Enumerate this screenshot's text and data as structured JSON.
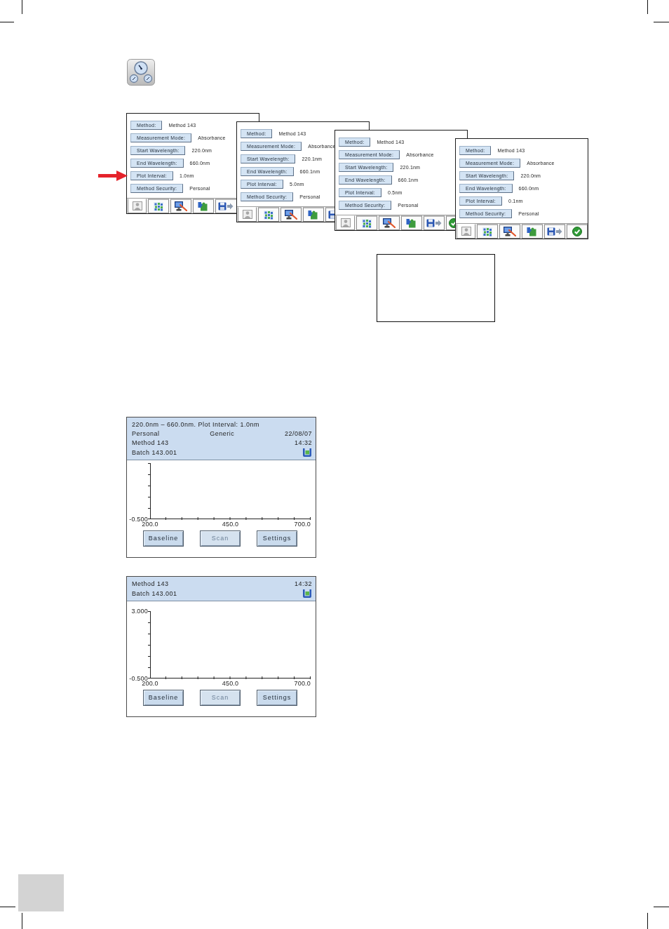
{
  "method_screens": [
    {
      "fields": [
        {
          "label": "Method:",
          "value": "Method 143",
          "arrow": false
        },
        {
          "label": "Measurement Mode:",
          "value": "Absorbance",
          "arrow": false
        },
        {
          "label": "Start Wavelength:",
          "value": "220.0nm",
          "arrow": false
        },
        {
          "label": "End Wavelength:",
          "value": "660.0nm",
          "arrow": false
        },
        {
          "label": "Plot Interval:",
          "value": "1.0nm",
          "arrow": true
        },
        {
          "label": "Method Security:",
          "value": "Personal",
          "arrow": false
        }
      ],
      "tabs": [
        {
          "kind": "user",
          "selected": true
        },
        {
          "kind": "grid",
          "selected": false
        },
        {
          "kind": "monitor",
          "selected": false
        },
        {
          "kind": "puzzle",
          "selected": false
        },
        {
          "kind": "save",
          "selected": false
        }
      ]
    },
    {
      "fields": [
        {
          "label": "Method:",
          "value": "Method 143",
          "arrow": false
        },
        {
          "label": "Measurement Mode:",
          "value": "Absorbance",
          "arrow": false
        },
        {
          "label": "Start Wavelength:",
          "value": "220.1nm",
          "arrow": false
        },
        {
          "label": "End Wavelength:",
          "value": "660.1nm",
          "arrow": false
        },
        {
          "label": "Plot Interval:",
          "value": "5.0nm",
          "arrow": false
        },
        {
          "label": "Method Security:",
          "value": "Personal",
          "arrow": false
        }
      ],
      "tabs": [
        {
          "kind": "user",
          "selected": true
        },
        {
          "kind": "grid",
          "selected": false
        },
        {
          "kind": "monitor",
          "selected": false
        },
        {
          "kind": "puzzle",
          "selected": false
        },
        {
          "kind": "save",
          "selected": false
        }
      ]
    },
    {
      "fields": [
        {
          "label": "Method:",
          "value": "Method 143",
          "arrow": false
        },
        {
          "label": "Measurement Mode:",
          "value": "Absorbance",
          "arrow": false
        },
        {
          "label": "Start Wavelength:",
          "value": "220.1nm",
          "arrow": false
        },
        {
          "label": "End Wavelength:",
          "value": "660.1nm",
          "arrow": false
        },
        {
          "label": "Plot Interval:",
          "value": "0.5nm",
          "arrow": false
        },
        {
          "label": "Method Security:",
          "value": "Personal",
          "arrow": false
        }
      ],
      "tabs": [
        {
          "kind": "user",
          "selected": true
        },
        {
          "kind": "grid",
          "selected": false
        },
        {
          "kind": "monitor",
          "selected": false
        },
        {
          "kind": "puzzle",
          "selected": false
        },
        {
          "kind": "save",
          "selected": false
        },
        {
          "kind": "check",
          "selected": false
        }
      ]
    },
    {
      "fields": [
        {
          "label": "Method:",
          "value": "Method 143",
          "arrow": false
        },
        {
          "label": "Measurement Mode:",
          "value": "Absorbance",
          "arrow": false
        },
        {
          "label": "Start Wavelength:",
          "value": "220.0nm",
          "arrow": false
        },
        {
          "label": "End Wavelength:",
          "value": "660.0nm",
          "arrow": false
        },
        {
          "label": "Plot Interval:",
          "value": "0.1nm",
          "arrow": false
        },
        {
          "label": "Method Security:",
          "value": "Personal",
          "arrow": false
        }
      ],
      "tabs": [
        {
          "kind": "user",
          "selected": true
        },
        {
          "kind": "grid",
          "selected": false
        },
        {
          "kind": "monitor",
          "selected": false
        },
        {
          "kind": "puzzle",
          "selected": false
        },
        {
          "kind": "save",
          "selected": false
        },
        {
          "kind": "check",
          "selected": false
        }
      ]
    }
  ],
  "scan_screens": [
    {
      "header_rows": [
        {
          "left": "220.0nm – 660.0nm. Plot Interval: 1.0nm"
        },
        {
          "left": "Personal",
          "center": "Generic",
          "right": "22/08/07"
        },
        {
          "left": "Method 143",
          "right": "14:32"
        },
        {
          "left": "Batch 143.001"
        }
      ],
      "y_axis": {
        "bottom_label": "-0.500"
      },
      "x_axis": {
        "labels": [
          "200.0",
          "450.0",
          "700.0"
        ]
      },
      "buttons": [
        {
          "label": "Baseline",
          "disabled": false
        },
        {
          "label": "Scan",
          "disabled": true
        },
        {
          "label": "Settings",
          "disabled": false
        }
      ]
    },
    {
      "header_rows": [
        {
          "left": "Method 143",
          "right": "14:32"
        },
        {
          "left": "Batch 143.001"
        }
      ],
      "y_axis": {
        "top_label": "3.000",
        "bottom_label": "-0.500"
      },
      "x_axis": {
        "labels": [
          "200.0",
          "450.0",
          "700.0"
        ]
      },
      "buttons": [
        {
          "label": "Baseline",
          "disabled": false
        },
        {
          "label": "Scan",
          "disabled": true
        },
        {
          "label": "Settings",
          "disabled": false
        }
      ]
    }
  ]
}
